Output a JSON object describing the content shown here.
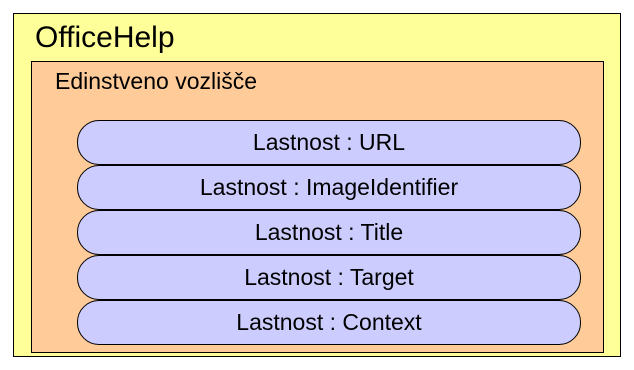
{
  "diagram": {
    "outer_label": "OfficeHelp",
    "inner_label": "Edinstveno vozlišče",
    "properties": [
      "Lastnost : URL",
      "Lastnost : ImageIdentifier",
      "Lastnost : Title",
      "Lastnost : Target",
      "Lastnost : Context"
    ]
  },
  "colors": {
    "outer_fill": "#ffff99",
    "inner_fill": "#ffcc99",
    "property_fill": "#ccccff",
    "border": "#000000"
  }
}
